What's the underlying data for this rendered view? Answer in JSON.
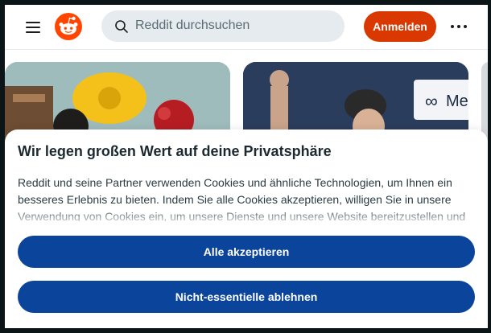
{
  "header": {
    "search_placeholder": "Reddit durchsuchen",
    "login_label": "Anmelden",
    "brand_color": "#d93900"
  },
  "feed": {
    "cards": [
      {
        "image": "colorful-objects-photo"
      },
      {
        "image": "person-on-stage-photo",
        "overlay_text": "Me"
      }
    ]
  },
  "cookie_banner": {
    "title": "Wir legen großen Wert auf deine Privatsphäre",
    "text": "Reddit und seine Partner verwenden Cookies und ähnliche Technologien, um Ihnen ein besseres Erlebnis zu bieten. Indem Sie alle Cookies akzeptieren, willigen Sie in unsere Verwendung von Cookies ein, um unsere Dienste und unsere Website bereitzustellen und zu",
    "accept_label": "Alle akzeptieren",
    "decline_label": "Nicht-essentielle ablehnen",
    "button_color": "#0a449b"
  }
}
